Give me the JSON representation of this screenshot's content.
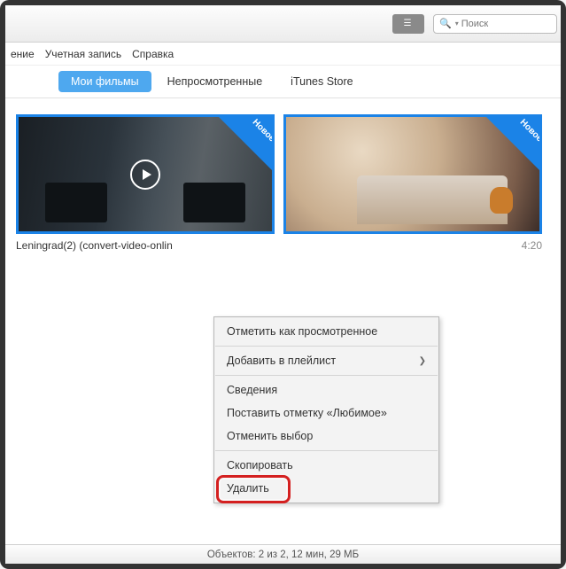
{
  "window_controls": {
    "min": "—",
    "max": "□",
    "close": "✕"
  },
  "titlebar": {
    "search_placeholder": "Поиск"
  },
  "menubar": {
    "item0": "ение",
    "item1": "Учетная запись",
    "item2": "Справка"
  },
  "tabs": {
    "my_movies": "Мои фильмы",
    "unwatched": "Непросмотренные",
    "store": "iTunes Store"
  },
  "movies": [
    {
      "title": "Leningrad(2)  (convert-video-onlin",
      "duration": "",
      "badge": "Новое"
    },
    {
      "title": "",
      "duration": "4:20",
      "badge": "Новое"
    }
  ],
  "context_menu": {
    "mark_watched": "Отметить как просмотренное",
    "add_playlist": "Добавить в плейлист",
    "info": "Сведения",
    "mark_favorite": "Поставить отметку «Любимое»",
    "deselect": "Отменить выбор",
    "copy": "Скопировать",
    "delete": "Удалить"
  },
  "statusbar": {
    "text": "Объектов: 2 из 2, 12 мин, 29 МБ"
  }
}
